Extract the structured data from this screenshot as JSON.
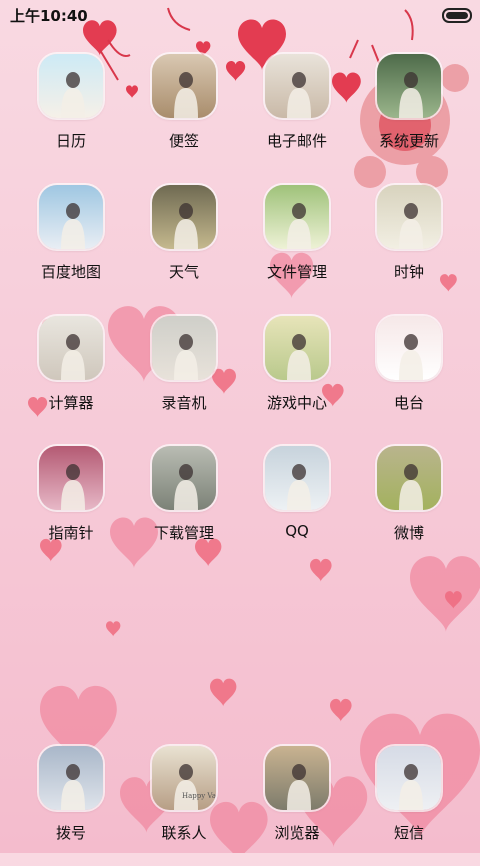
{
  "status_bar": {
    "time": "上午10:40"
  },
  "apps": [
    {
      "id": "calendar",
      "label": "日历",
      "theme": [
        "#cdeaf5",
        "#f6f0e8"
      ]
    },
    {
      "id": "notes",
      "label": "便签",
      "theme": [
        "#d9c8b2",
        "#a98d6c"
      ]
    },
    {
      "id": "email",
      "label": "电子邮件",
      "theme": [
        "#e9e3da",
        "#c9b9a7"
      ]
    },
    {
      "id": "system-update",
      "label": "系统更新",
      "theme": [
        "#4e6b4a",
        "#9bb68c"
      ]
    },
    {
      "id": "baidu-map",
      "label": "百度地图",
      "theme": [
        "#9fc7e2",
        "#e9eef4"
      ]
    },
    {
      "id": "weather",
      "label": "天气",
      "theme": [
        "#6f6a52",
        "#c5b98e"
      ]
    },
    {
      "id": "file-manager",
      "label": "文件管理",
      "theme": [
        "#9fc27a",
        "#eef2d6"
      ]
    },
    {
      "id": "clock",
      "label": "时钟",
      "theme": [
        "#d8d3be",
        "#f2efe3"
      ]
    },
    {
      "id": "calculator",
      "label": "计算器",
      "theme": [
        "#e9e6df",
        "#cfc7bc"
      ]
    },
    {
      "id": "recorder",
      "label": "录音机",
      "theme": [
        "#cfcfc9",
        "#e8e2da"
      ]
    },
    {
      "id": "game-center",
      "label": "游戏中心",
      "theme": [
        "#e7e4b9",
        "#b9c98c"
      ]
    },
    {
      "id": "radio",
      "label": "电台",
      "theme": [
        "#f6e8e8",
        "#ffffff"
      ]
    },
    {
      "id": "compass",
      "label": "指南针",
      "theme": [
        "#b45a73",
        "#e7b8c7"
      ]
    },
    {
      "id": "download-manager",
      "label": "下载管理",
      "theme": [
        "#b9bcb3",
        "#7c8277"
      ]
    },
    {
      "id": "qq",
      "label": "QQ",
      "theme": [
        "#c7d3dc",
        "#edf1f4"
      ]
    },
    {
      "id": "weibo",
      "label": "微博",
      "theme": [
        "#b9b48d",
        "#a3b25e"
      ]
    }
  ],
  "dock": [
    {
      "id": "dialer",
      "label": "拨号",
      "theme": [
        "#a9b7c9",
        "#dfe4eb"
      ]
    },
    {
      "id": "contacts",
      "label": "联系人",
      "theme": [
        "#e9e2d2",
        "#b79e85"
      ],
      "note": "Happy Valen"
    },
    {
      "id": "browser",
      "label": "浏览器",
      "theme": [
        "#c9b391",
        "#7d7b6b"
      ]
    },
    {
      "id": "messages",
      "label": "短信",
      "theme": [
        "#d6dbe6",
        "#eef0f3"
      ]
    }
  ]
}
